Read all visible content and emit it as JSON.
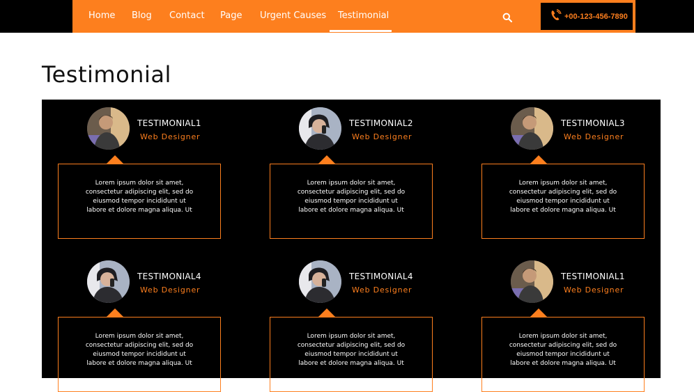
{
  "nav": {
    "items": [
      {
        "label": "Home"
      },
      {
        "label": "Blog"
      },
      {
        "label": "Contact"
      },
      {
        "label": "Page"
      },
      {
        "label": "Urgent Causes"
      },
      {
        "label": "Testimonial",
        "active": true
      }
    ],
    "search_icon": "search-icon",
    "phone": {
      "icon": "phone-icon",
      "number": "+00-123-456-7890"
    }
  },
  "page": {
    "title": "Testimonial"
  },
  "testimonials": [
    {
      "name": "TESTIMONIAL1",
      "role": "Web Designer",
      "text": "Lorem ipsum dolor sit amet, consectetur adipiscing elit, sed do eiusmod tempor incididunt ut labore et dolore magna aliqua. Ut",
      "avatar": "man-portrait"
    },
    {
      "name": "TESTIMONIAL2",
      "role": "Web Designer",
      "text": "Lorem ipsum dolor sit amet, consectetur adipiscing elit, sed do eiusmod tempor incididunt ut labore et dolore magna aliqua. Ut",
      "avatar": "woman-portrait"
    },
    {
      "name": "TESTIMONIAL3",
      "role": "Web Designer",
      "text": "Lorem ipsum dolor sit amet, consectetur adipiscing elit, sed do eiusmod tempor incididunt ut labore et dolore magna aliqua. Ut",
      "avatar": "man-portrait"
    },
    {
      "name": "TESTIMONIAL4",
      "role": "Web Designer",
      "text": "Lorem ipsum dolor sit amet, consectetur adipiscing elit, sed do eiusmod tempor incididunt ut labore et dolore magna aliqua. Ut",
      "avatar": "woman-portrait"
    },
    {
      "name": "TESTIMONIAL4",
      "role": "Web Designer",
      "text": "Lorem ipsum dolor sit amet, consectetur adipiscing elit, sed do eiusmod tempor incididunt ut labore et dolore magna aliqua. Ut",
      "avatar": "woman-portrait"
    },
    {
      "name": "TESTIMONIAL1",
      "role": "Web Designer",
      "text": "Lorem ipsum dolor sit amet, consectetur adipiscing elit, sed do eiusmod tempor incididunt ut labore et dolore magna aliqua. Ut",
      "avatar": "man-portrait"
    }
  ],
  "colors": {
    "accent": "#fd7f1e",
    "panel": "#000000",
    "text": "#ffffff",
    "title": "#111111"
  }
}
